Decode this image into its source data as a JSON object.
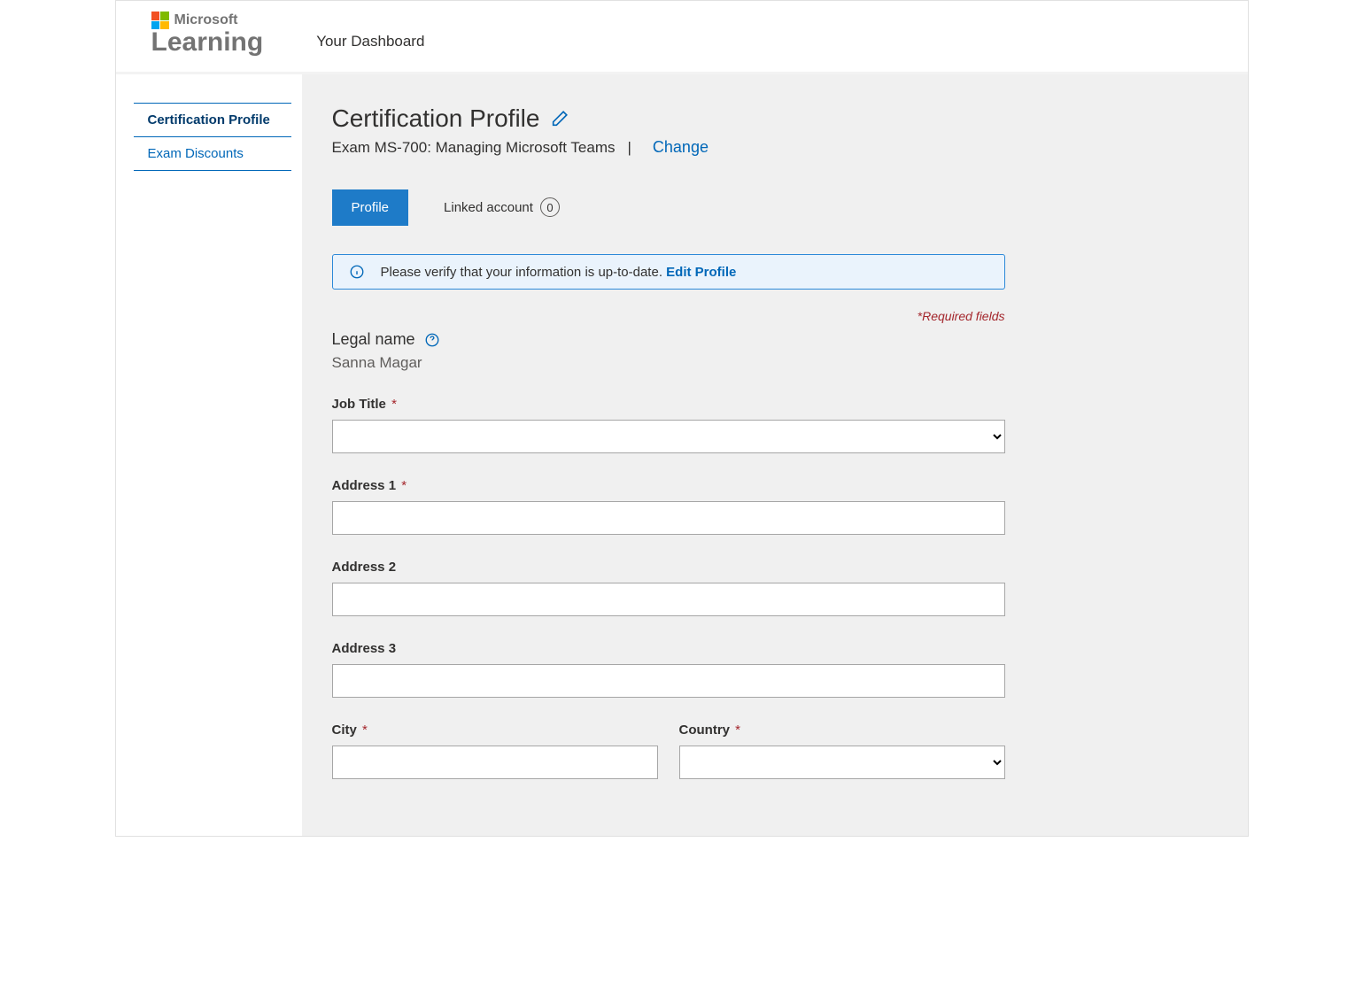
{
  "header": {
    "microsoft": "Microsoft",
    "learning": "Learning",
    "dashboard": "Your Dashboard"
  },
  "sidebar": {
    "items": [
      {
        "label": "Certification Profile",
        "active": true
      },
      {
        "label": "Exam Discounts",
        "active": false
      }
    ]
  },
  "page": {
    "title": "Certification Profile",
    "exam_line": "Exam MS-700: Managing Microsoft Teams",
    "divider": "|",
    "change": "Change"
  },
  "tabs": {
    "profile": "Profile",
    "linked": "Linked account",
    "linked_count": "0"
  },
  "banner": {
    "text": "Please verify that your information is up-to-date. ",
    "edit": "Edit Profile"
  },
  "required_note": "*Required fields",
  "legal_name": {
    "label": "Legal name",
    "value": "Sanna Magar"
  },
  "fields": {
    "job_title": {
      "label": "Job Title",
      "value": ""
    },
    "address1": {
      "label": "Address 1",
      "value": ""
    },
    "address2": {
      "label": "Address 2",
      "value": ""
    },
    "address3": {
      "label": "Address 3",
      "value": ""
    },
    "city": {
      "label": "City",
      "value": ""
    },
    "country": {
      "label": "Country",
      "value": ""
    }
  },
  "required_marker": "*"
}
